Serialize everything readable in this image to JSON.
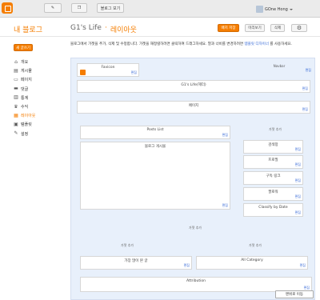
{
  "topbar": {
    "view_blog": "블로그 보기",
    "user_name": "GOne Hong"
  },
  "header": {
    "brand": "내 블로그",
    "blog_title": "G1's Life",
    "separator": "·",
    "page_title": "레이아웃",
    "save_label": "배치 저장",
    "preview_label": "미리보기",
    "clear_label": "삭제"
  },
  "sidebar": {
    "new_post": "새 글쓰기",
    "items": [
      {
        "label": "개요",
        "icon": "home-icon"
      },
      {
        "label": "게시물",
        "icon": "posts-icon"
      },
      {
        "label": "페이지",
        "icon": "pages-icon"
      },
      {
        "label": "댓글",
        "icon": "comments-icon"
      },
      {
        "label": "통계",
        "icon": "stats-icon"
      },
      {
        "label": "수익",
        "icon": "earnings-icon"
      },
      {
        "label": "레이아웃",
        "icon": "layout-icon",
        "active": true
      },
      {
        "label": "템플릿",
        "icon": "template-icon"
      },
      {
        "label": "설정",
        "icon": "settings-icon"
      }
    ]
  },
  "main": {
    "description_before": "블로그에서 가젯을 추가, 삭제 및 수정합니다. 가젯을 재정렬하려면 클릭하여 드래그하세요. 열과 너비를 변경하려면",
    "description_link": "템플릿 디자이너",
    "description_after": "를 사용하세요.",
    "edit_label": "편집",
    "favicon_title": "Favicon",
    "navbar_title": "Navbar",
    "header_title": "G1's Life(헤더)",
    "pages_title": "페이지",
    "posts_list_title": "Posts List",
    "blog_posts_title": "블로그 게시물",
    "add_gadget": "가젯 추가",
    "side_widgets": [
      "검색창",
      "프로필",
      "구독 링크",
      "팔로워",
      "Classify by Date"
    ],
    "popular_posts_title": "가장 많이 본 글",
    "all_category_title": "All Category",
    "attribution_title": "Attribution",
    "back_to_top": "맨위로 이동"
  }
}
